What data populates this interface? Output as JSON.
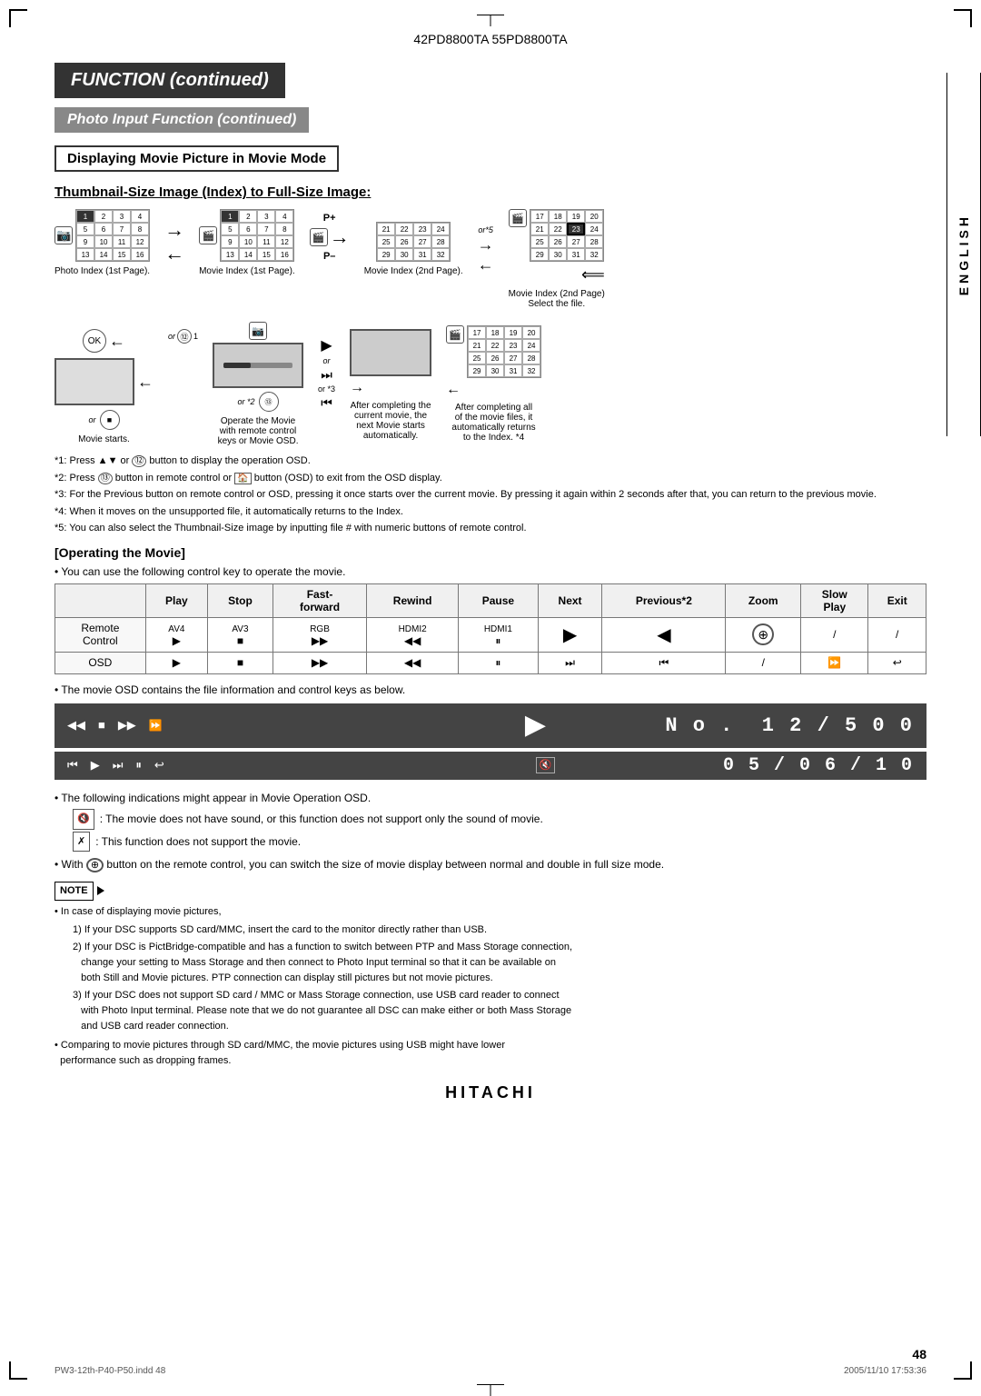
{
  "page": {
    "model_number": "42PD8800TA  55PD8800TA",
    "page_number": "48",
    "brand": "HITACHI",
    "side_label": "ENGLISH",
    "footer_file": "PW3-12th-P40-P50.indd  48",
    "footer_date": "2005/11/10  17:53:36"
  },
  "banners": {
    "function": "FUNCTION (continued)",
    "photo_input": "Photo Input Function (continued)",
    "movie_mode": "Displaying Movie Picture in Movie Mode"
  },
  "thumbnail_section": {
    "title": "Thumbnail-Size Image (Index) to Full-Size Image:",
    "labels": {
      "photo_index": "Photo Index (1st Page).",
      "movie_index_1": "Movie Index (1st Page).",
      "movie_index_2": "Movie Index (2nd Page).",
      "movie_index_2nd_select": "Movie Index (2nd Page)\nSelect the file.",
      "movie_starts": "Movie starts.",
      "operate_movie": "Operate the Movie\nwith remote control\nkeys or Movie OSD.",
      "after_current": "After completing the\ncurrent movie, the\nnext Movie starts\nautomatically.",
      "after_all": "After completing all\nof the movie files, it\nautomatically returns\nto the Index. *4"
    }
  },
  "footnotes": [
    "*1: Press ▲▼ or ⑫ button to display the operation OSD.",
    "*2: Press ⑬ button in remote control or 🏠 button (OSD) to exit from the OSD display.",
    "*3: For the Previous button on remote control or OSD, pressing it once starts over the current movie. By pressing it again within 2 seconds after that, you can return to the previous movie.",
    "*4: When it moves on the unsupported file, it automatically returns to the Index.",
    "*5: You can also select the Thumbnail-Size image by inputting file # with numeric buttons of remote control."
  ],
  "operating_movie": {
    "title": "[Operating the Movie]",
    "subtitle": "• You can use the following control key to operate the movie.",
    "table": {
      "header": [
        "",
        "Play",
        "Stop",
        "Fast-forward",
        "Rewind",
        "Pause",
        "Next",
        "Previous*2",
        "Zoom",
        "Slow Play",
        "Exit"
      ],
      "rows": [
        {
          "label": "Remote\nControl",
          "cells": [
            "AV4 ▶",
            "AV3 ■",
            "RGB ▶▶",
            "HDMI2 ◀◀",
            "HDMI1 ⏸",
            "▶",
            "◀",
            "⊕",
            "/",
            "/"
          ]
        },
        {
          "label": "OSD",
          "cells": [
            "▶",
            "■",
            "▶▶",
            "◀◀",
            "⏸",
            "⏭",
            "⏮",
            "/",
            "⏩",
            "↩"
          ]
        }
      ]
    },
    "osd_note": "• The movie OSD contains the file information and control keys as below.",
    "osd_bar1": {
      "controls": [
        "◀◀",
        "■",
        "▶▶",
        "⏩"
      ],
      "info": "No. 12/500"
    },
    "osd_bar2": {
      "controls": [
        "⏮",
        "▶",
        "⏭",
        "⏸",
        "↩",
        "🔇"
      ],
      "info": "05/06/10"
    },
    "bullets": [
      "• The following indications might appear in Movie Operation OSD.",
      "🔇 : The movie does not have sound, or this function does not support only the sound of movie.",
      "✗ : This function does not support the movie.",
      "• With ⊕ button on the remote control, you can switch the size of movie display between normal and double in full size mode."
    ]
  },
  "note_section": {
    "header": "NOTE",
    "intro": "• In case of displaying movie pictures,",
    "items": [
      "1) If your DSC supports SD card/MMC, insert the card to the monitor directly rather than USB.",
      "2) If your DSC is PictBridge-compatible and has a function to switch between PTP and Mass Storage connection, change your setting to Mass Storage and then connect to Photo Input terminal so that it can be available on both Still and Movie pictures. PTP connection can display still pictures but not movie pictures.",
      "3) If your DSC does not support SD card / MMC or Mass Storage connection, use USB card reader to connect with Photo Input terminal. Please note that we do not guarantee all DSC can make either or both Mass Storage and USB card reader connection.",
      "• Comparing to movie pictures through SD card/MMC, the movie pictures using USB might have lower performance such as dropping frames."
    ]
  },
  "grids": {
    "photo_index": [
      [
        1,
        2,
        3,
        4
      ],
      [
        5,
        6,
        7,
        8
      ],
      [
        9,
        10,
        11,
        12
      ],
      [
        13,
        14,
        15,
        16
      ]
    ],
    "movie_index1": [
      [
        1,
        2,
        3,
        4
      ],
      [
        5,
        6,
        7,
        8
      ],
      [
        9,
        10,
        11,
        12
      ],
      [
        13,
        14,
        15,
        16
      ]
    ],
    "movie_index2a": [
      [
        21,
        22,
        23,
        24
      ],
      [
        25,
        26,
        27,
        28
      ],
      [
        29,
        30,
        31,
        32
      ]
    ],
    "movie_index2b": [
      [
        17,
        18,
        19,
        20
      ],
      [
        21,
        22,
        23,
        24
      ],
      [
        25,
        26,
        27,
        28
      ],
      [
        29,
        30,
        31,
        32
      ]
    ],
    "movie_index2c": [
      [
        17,
        18,
        19,
        20
      ],
      [
        21,
        22,
        23,
        24
      ],
      [
        25,
        26,
        27,
        28
      ],
      [
        29,
        30,
        31,
        32
      ]
    ],
    "after_all_grid": [
      [
        17,
        18,
        19,
        20
      ],
      [
        21,
        22,
        23,
        24
      ],
      [
        25,
        26,
        27,
        28
      ],
      [
        29,
        30,
        31,
        32
      ]
    ]
  }
}
